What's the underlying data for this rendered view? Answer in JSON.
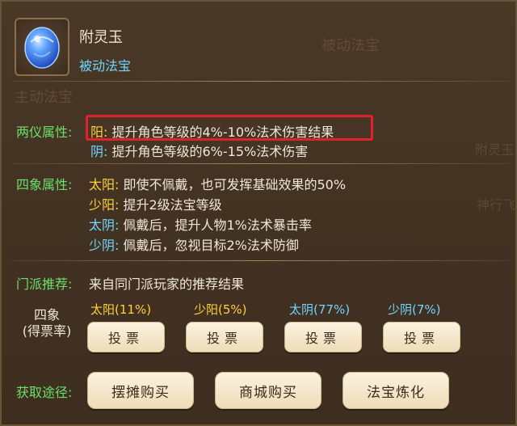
{
  "item": {
    "name": "附灵玉",
    "type": "被动法宝",
    "gem_color": "#3b7dff"
  },
  "background_ghosts": [
    "被动法宝",
    "主动法宝",
    "附灵玉",
    "神行飞"
  ],
  "two_forms": {
    "label": "两仪属性:",
    "yang_tag": "阳:",
    "yang_text": "提升角色等级的4%-10%法术伤害结果",
    "yin_tag": "阴:",
    "yin_text": "提升角色等级的6%-15%法术伤害"
  },
  "four_forms": {
    "label": "四象属性:",
    "rows": [
      {
        "tag": "太阳:",
        "text": "即使不佩戴，也可发挥基础效果的50%"
      },
      {
        "tag": "少阳:",
        "text": "提升2级法宝等级"
      },
      {
        "tag": "太阴:",
        "text": "佩戴后，提升人物1%法术暴击率"
      },
      {
        "tag": "少阴:",
        "text": "佩戴后，忽视目标2%法术防御"
      }
    ]
  },
  "sect": {
    "label": "门派推荐:",
    "text": "来自同门派玩家的推荐结果"
  },
  "vote": {
    "head_line1": "四象",
    "head_line2": "(得票率)",
    "options": [
      {
        "label": "太阳(11%)",
        "button": "投票"
      },
      {
        "label": "少阳(5%)",
        "button": "投票"
      },
      {
        "label": "太阴(77%)",
        "button": "投票"
      },
      {
        "label": "少阴(7%)",
        "button": "投票"
      }
    ]
  },
  "acquire": {
    "label": "获取途径:",
    "buttons": [
      "摆摊购买",
      "商城购买",
      "法宝炼化"
    ]
  },
  "colors": {
    "green_label": "#68e06a",
    "yellow": "#ffd23a",
    "cyan": "#6fd6ff",
    "highlight_red": "#e0232a"
  }
}
